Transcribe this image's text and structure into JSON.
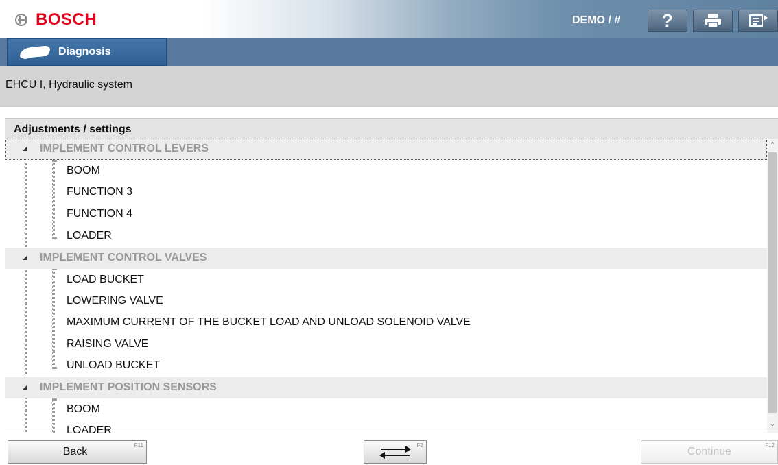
{
  "header": {
    "brand": "BOSCH",
    "user": "DEMO / #",
    "buttons": {
      "help_icon": "help-icon",
      "print_icon": "print-icon",
      "menu_icon": "menu-export-icon"
    }
  },
  "tab": {
    "label": "Diagnosis",
    "icon": "car-diagnosis-icon"
  },
  "context": {
    "text": "EHCU I, Hydraulic system"
  },
  "panel": {
    "title": "Adjustments / settings",
    "groups": [
      {
        "label": "IMPLEMENT CONTROL LEVERS",
        "items": [
          "BOOM",
          "FUNCTION 3",
          "FUNCTION 4",
          "LOADER"
        ]
      },
      {
        "label": "IMPLEMENT CONTROL VALVES",
        "items": [
          "LOAD BUCKET",
          "LOWERING VALVE",
          "MAXIMUM CURRENT OF THE BUCKET LOAD AND UNLOAD SOLENOID VALVE",
          "RAISING VALVE",
          "UNLOAD BUCKET"
        ]
      },
      {
        "label": "IMPLEMENT POSITION SENSORS",
        "items": [
          "BOOM",
          "LOADER"
        ]
      }
    ]
  },
  "footer": {
    "back": {
      "label": "Back",
      "key": "F11"
    },
    "switch": {
      "key": "F2",
      "icon": "swap-arrows-icon"
    },
    "continue": {
      "label": "Continue",
      "key": "F12",
      "enabled": false
    }
  },
  "colors": {
    "brand_red": "#e2001a",
    "tab_blue": "#3a6b9e",
    "tabbar": "#5878a0",
    "group_text": "#999999"
  }
}
